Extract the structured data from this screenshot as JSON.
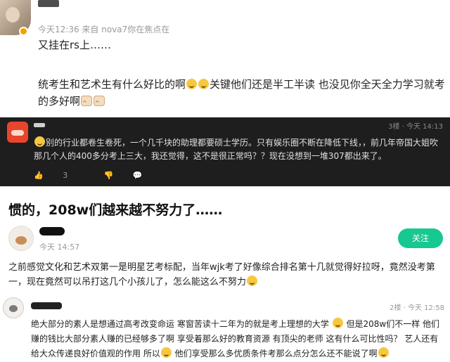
{
  "post1": {
    "meta": "今天12:36 来自 nova7你在焦点在",
    "line1": "又挂在rs上……",
    "line2a": "统考生和艺术生有什么好比的啊",
    "line2b": "关键他们还是半工半读 也没见你全天全力学习就考的多好啊"
  },
  "post2": {
    "meta": "3楼 · 今天 14:13",
    "text_a": "别的行业都卷生卷死，一个几千块的助理都要硕士学历。只有娱乐圈不断在降低下线，，前几年帝国大姐吹那几个人的400多分考上三大，我还觉得，这不是很正常吗？？现在没想到一堆307都出来了。",
    "likes": "3",
    "icons": [
      "like-icon",
      "dislike-icon",
      "comment-icon"
    ]
  },
  "headline": "惯的，208w们越来越不努力了……",
  "post3": {
    "meta": "今天 14:57",
    "follow_label": "关注",
    "text": "之前感觉文化和艺术双第一是明星艺考标配，当年wjk考了好像综合排名第十几就觉得好拉呀，竟然没考第一，现在竟然可以吊打这几个小孩儿了，怎么能这么不努力"
  },
  "post4": {
    "meta": "2楼 · 今天 12:58",
    "text_a": "绝大部分的素人是想通过高考改变命运 寒窗苦读十二年为的就是考上理想的大学",
    "text_b": "但是208w们不一样 他们赚的钱比大部分素人赚的已经够多了啊 享受着那么好的教育资源 有顶尖的老师 这有什么可比性吗？ 艺人还有给大众传递良好价值观的作用 所以",
    "text_c": "他们享受那么多优质条件考那么点分怎么还不能说了啊"
  },
  "colors": {
    "follow_button": "#17c890",
    "dark_bg": "#1e1e1e"
  }
}
